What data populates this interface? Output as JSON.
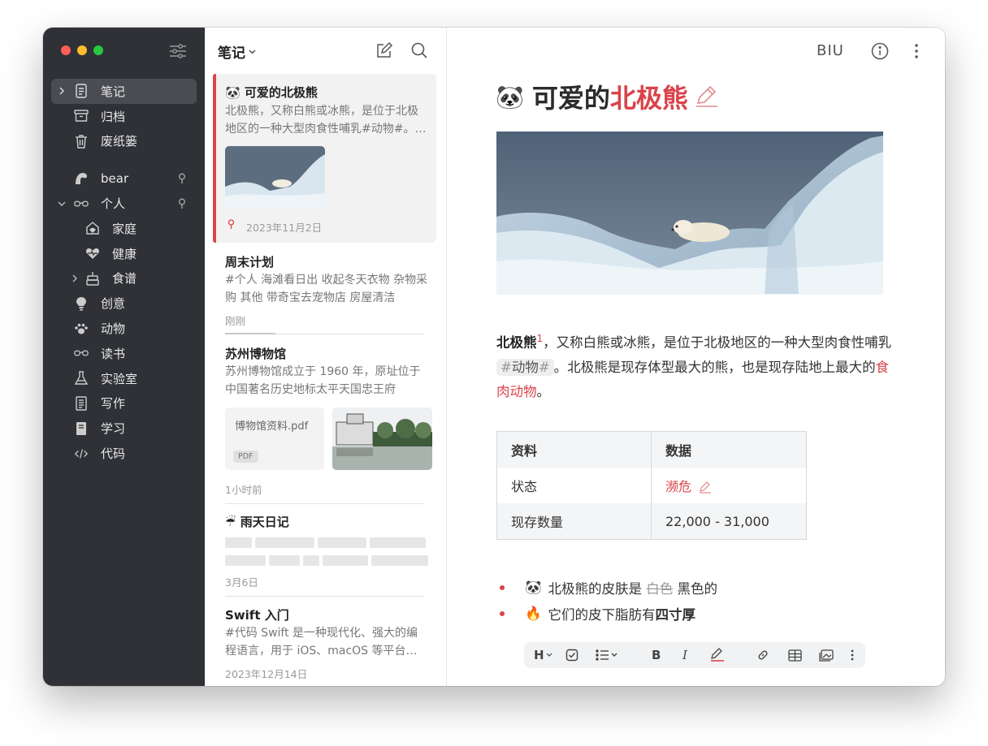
{
  "sidebar": {
    "items": [
      {
        "label": "笔记",
        "icon": "note-icon"
      },
      {
        "label": "归档",
        "icon": "archive-icon"
      },
      {
        "label": "废纸篓",
        "icon": "trash-icon"
      },
      {
        "label": "bear",
        "icon": "bear-icon"
      },
      {
        "label": "个人",
        "icon": "glasses-icon"
      },
      {
        "label": "家庭",
        "icon": "home-icon"
      },
      {
        "label": "健康",
        "icon": "heart-icon"
      },
      {
        "label": "食谱",
        "icon": "cake-icon"
      },
      {
        "label": "创意",
        "icon": "bulb-icon"
      },
      {
        "label": "动物",
        "icon": "paw-icon"
      },
      {
        "label": "读书",
        "icon": "glasses-icon"
      },
      {
        "label": "实验室",
        "icon": "flask-icon"
      },
      {
        "label": "写作",
        "icon": "document-icon"
      },
      {
        "label": "学习",
        "icon": "book-icon"
      },
      {
        "label": "代码",
        "icon": "code-icon"
      }
    ]
  },
  "list": {
    "header": "笔记",
    "notes": [
      {
        "emoji": "🐼",
        "title": "可爱的北极熊",
        "body": "北极熊，又称白熊或冰熊，是位于北极地区的一种大型肉食性哺乳#动物#。北极熊是现存体型最大的熊",
        "date": "2023年11月2日"
      },
      {
        "title": "周末计划",
        "body": "#个人 海滩看日出 收起冬天衣物 杂物采购 其他 带奇宝去宠物店 房屋清洁",
        "date": "刚刚"
      },
      {
        "title": "苏州博物馆",
        "body": "苏州博物馆成立于 1960 年，原址位于中国著名历史地标太平天国忠王府",
        "pdf_name": "博物馆资料.pdf",
        "pdf_badge": "PDF",
        "date": "1小时前"
      },
      {
        "emoji": "☔",
        "title": "雨天日记",
        "date": "3月6日"
      },
      {
        "title": "Swift 入门",
        "body": "#代码 Swift 是一种现代化、强大的编程语言，用于 iOS、macOS 等平台的开发",
        "date": "2023年12月14日"
      }
    ]
  },
  "editor": {
    "format_label": "BIU",
    "title_emoji": "🐼",
    "title_plain": "可爱的",
    "title_red": "北极熊",
    "para": {
      "bold": "北极熊",
      "sup": "1",
      "t1": "，又称白熊或冰熊，是位于北极地区的一种大型肉食性哺乳",
      "tag_hash": "#",
      "tag_text": "动物",
      "t2": "。北极熊是现存体型最大的熊，也是现存陆地上最大的",
      "link": "食肉动物",
      "t3": "。"
    },
    "table": {
      "headers": [
        "资料",
        "数据"
      ],
      "rows": [
        [
          "状态",
          "濒危"
        ],
        [
          "现存数量",
          "22,000 - 31,000"
        ]
      ]
    },
    "bullets": [
      {
        "emoji": "🐼",
        "pre": "北极熊的皮肤是 ",
        "strike": "白色",
        "post": " 黑色的"
      },
      {
        "emoji": "🔥",
        "pre": "它们的皮下脂肪有",
        "bold": "四寸厚"
      }
    ],
    "toolbar": {
      "heading": "H",
      "bold": "B",
      "italic": "I"
    }
  },
  "colors": {
    "accent": "#d9434a",
    "sidebar_bg": "#2f3136",
    "selected_bg": "#f2f2f2"
  }
}
